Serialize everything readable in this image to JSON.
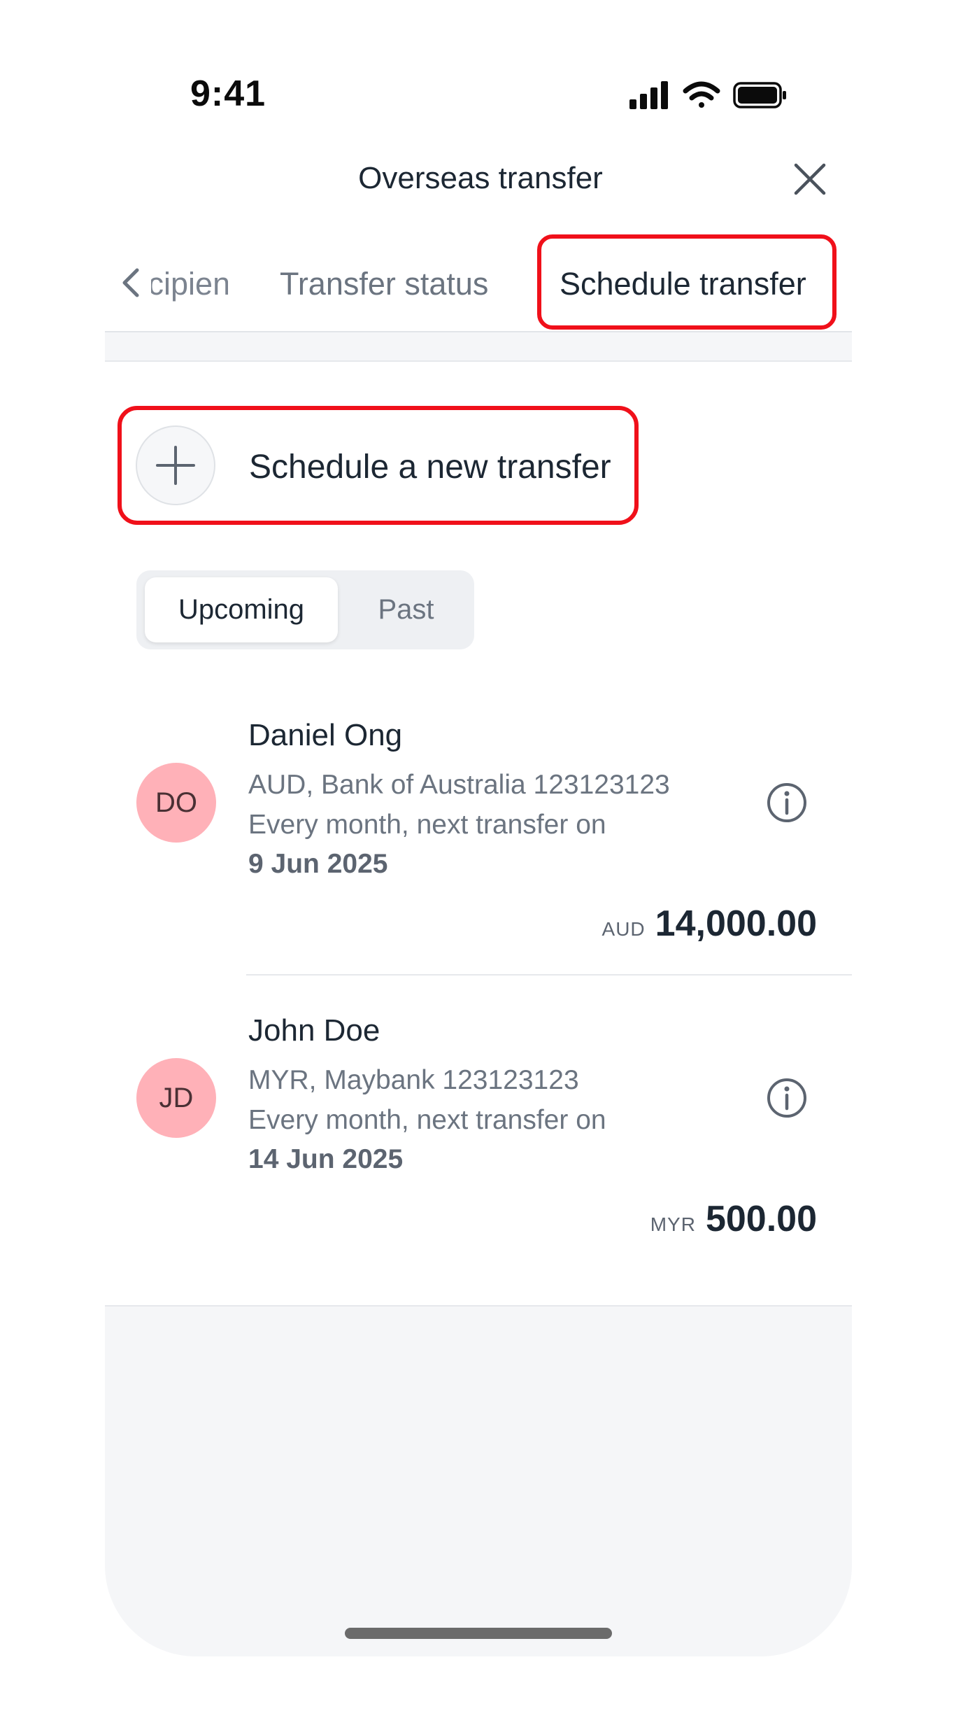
{
  "status_bar": {
    "time": "9:41"
  },
  "header": {
    "title": "Overseas transfer"
  },
  "tabs": [
    {
      "label": "Recipients"
    },
    {
      "label": "Transfer status"
    },
    {
      "label": "Schedule transfer"
    }
  ],
  "schedule": {
    "new_label": "Schedule a new transfer"
  },
  "segment": {
    "upcoming": "Upcoming",
    "past": "Past"
  },
  "transfers": [
    {
      "initials": "DO",
      "name": "Daniel Ong",
      "account": "AUD, Bank of Australia 123123123",
      "frequency": "Every month, next transfer on",
      "next_date": "9 Jun 2025",
      "currency": "AUD",
      "amount": "14,000.00"
    },
    {
      "initials": "JD",
      "name": "John Doe",
      "account": "MYR, Maybank 123123123",
      "frequency": "Every month, next transfer on",
      "next_date": "14 Jun 2025",
      "currency": "MYR",
      "amount": "500.00"
    }
  ],
  "colors": {
    "highlight": "#f0101a",
    "avatar": "#ffb1b8",
    "text_primary": "#1c2733",
    "text_secondary": "#6b7480"
  }
}
